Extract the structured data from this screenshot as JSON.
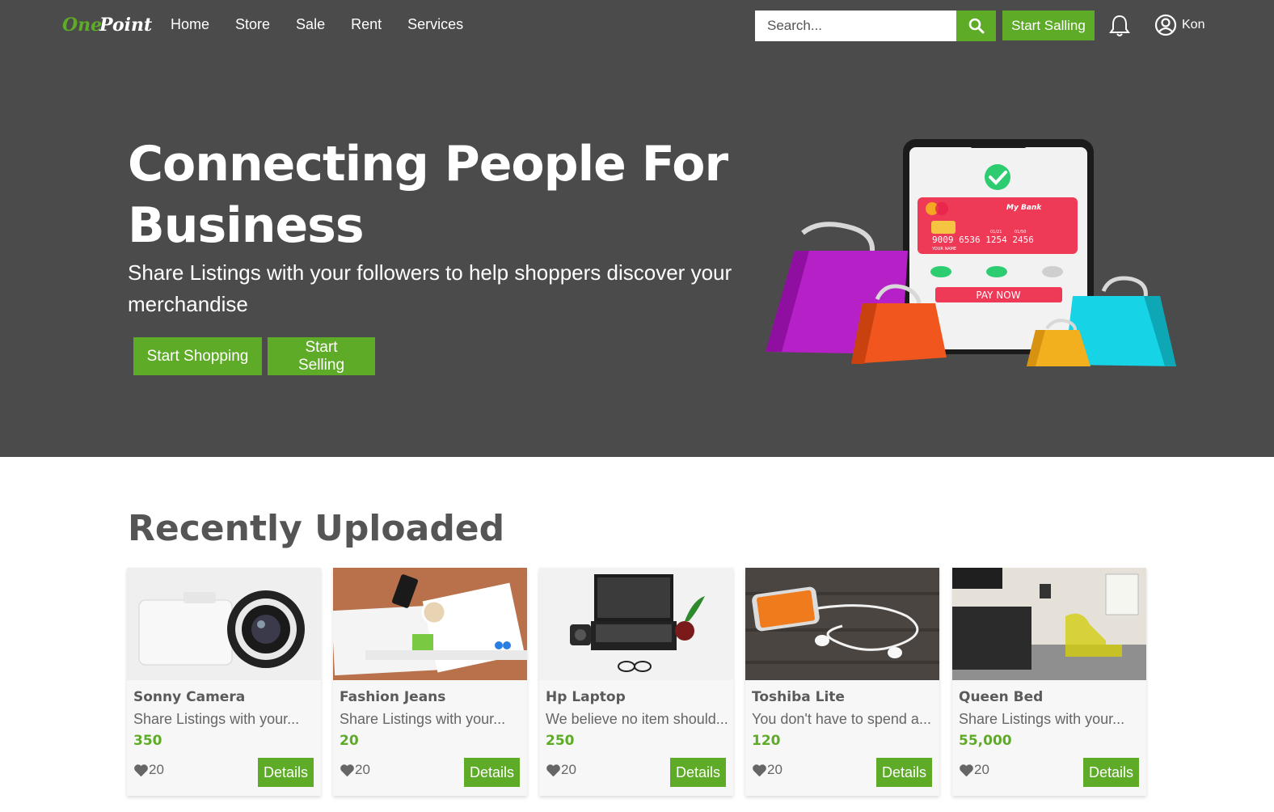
{
  "brand": {
    "logo_text_1": "One",
    "logo_text_2": "Point"
  },
  "nav": {
    "links": [
      "Home",
      "Store",
      "Sale",
      "Rent",
      "Services"
    ],
    "search_placeholder": "Search...",
    "start_salling_label": "Start Salling",
    "user_name": "Kon"
  },
  "hero": {
    "title": "Connecting People For Business",
    "subtitle": "Share Listings with your followers to help shoppers discover your merchandise",
    "primary_button": "Start Shopping",
    "secondary_button": "Start Selling",
    "art": {
      "bank_name": "My Bank",
      "card_number": "9009 6536 1254 2456",
      "card_holder": "YOUR NAME",
      "card_expiry_a": "01/21",
      "card_expiry_b": "01/50",
      "pay_button": "PAY NOW"
    }
  },
  "recent": {
    "heading": "Recently Uploaded",
    "items": [
      {
        "title": "Sonny Camera",
        "description": "Share Listings with your...",
        "price": "350",
        "likes": "20",
        "details_label": "Details",
        "image": "camera-photo"
      },
      {
        "title": "Fashion Jeans",
        "description": "Share Listings with your...",
        "price": "20",
        "likes": "20",
        "details_label": "Details",
        "image": "desk-photo"
      },
      {
        "title": "Hp Laptop",
        "description": "We believe no item should...",
        "price": "250",
        "likes": "20",
        "details_label": "Details",
        "image": "laptop-photo"
      },
      {
        "title": "Toshiba Lite",
        "description": "You don't have to spend a...",
        "price": "120",
        "likes": "20",
        "details_label": "Details",
        "image": "phone-earphones-photo"
      },
      {
        "title": "Queen Bed",
        "description": "Share Listings with your...",
        "price": "55,000",
        "likes": "20",
        "details_label": "Details",
        "image": "bedroom-photo"
      }
    ]
  },
  "colors": {
    "nav_bg": "#4b4b4b",
    "accent": "#5eab27",
    "card_bg": "#f7f7f7"
  }
}
